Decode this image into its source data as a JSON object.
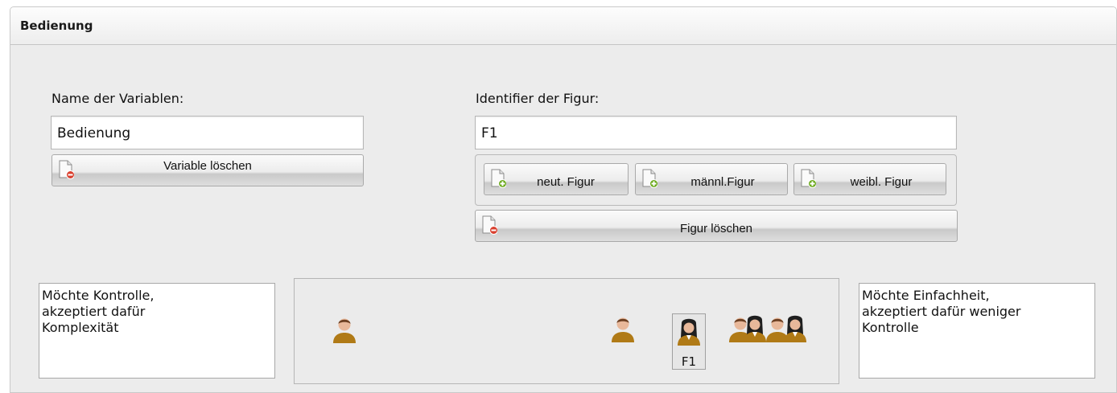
{
  "panel": {
    "title": "Bedienung"
  },
  "variable": {
    "name_label": "Name der Variablen:",
    "name_value": "Bedienung",
    "delete_button": "Variable löschen"
  },
  "figure": {
    "identifier_label": "Identifier der Figur:",
    "identifier_value": "F1",
    "add_neutral": "neut. Figur",
    "add_male": "männl.Figur",
    "add_female": "weibl. Figur",
    "delete_button": "Figur löschen"
  },
  "scale": {
    "left_pole": "Möchte Kontrolle,\nakzeptiert dafür\nKomplexität",
    "right_pole": "Möchte Einfachheit,\nakzeptiert dafür weniger\nKontrolle",
    "selected_figure_id": "F1"
  },
  "icons": {
    "add": "document-add-icon",
    "delete": "document-delete-icon",
    "male": "person-male-icon",
    "female": "person-female-icon"
  },
  "colors": {
    "add_badge": "#6aa81a",
    "delete_badge": "#d9402f",
    "figure_body": "#b07a16",
    "figure_skin": "#e8b89a"
  }
}
